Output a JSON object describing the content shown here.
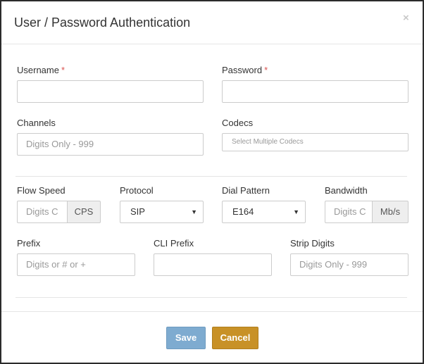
{
  "dialog": {
    "title": "User / Password Authentication",
    "close_glyph": "×"
  },
  "fields": {
    "username": {
      "label": "Username",
      "required_mark": "*",
      "value": ""
    },
    "password": {
      "label": "Password",
      "required_mark": "*",
      "value": ""
    },
    "channels": {
      "label": "Channels",
      "placeholder": "Digits Only - 999"
    },
    "codecs": {
      "label": "Codecs",
      "placeholder": "Select Multiple Codecs"
    },
    "flow_speed": {
      "label": "Flow Speed",
      "placeholder": "Digits C",
      "addon": "CPS"
    },
    "protocol": {
      "label": "Protocol",
      "selected": "SIP",
      "caret_glyph": "▼"
    },
    "dial_pattern": {
      "label": "Dial Pattern",
      "selected": "E164",
      "caret_glyph": "▼"
    },
    "bandwidth": {
      "label": "Bandwidth",
      "placeholder": "Digits C",
      "addon": "Mb/s"
    },
    "prefix": {
      "label": "Prefix",
      "placeholder": "Digits or # or +"
    },
    "cli_prefix": {
      "label": "CLI Prefix",
      "value": ""
    },
    "strip_digits": {
      "label": "Strip Digits",
      "placeholder": "Digits Only - 999"
    }
  },
  "footer": {
    "save_label": "Save",
    "cancel_label": "Cancel"
  },
  "colors": {
    "save_button": "#7eabd0",
    "cancel_button": "#c89127",
    "required_mark": "#d9534f"
  }
}
